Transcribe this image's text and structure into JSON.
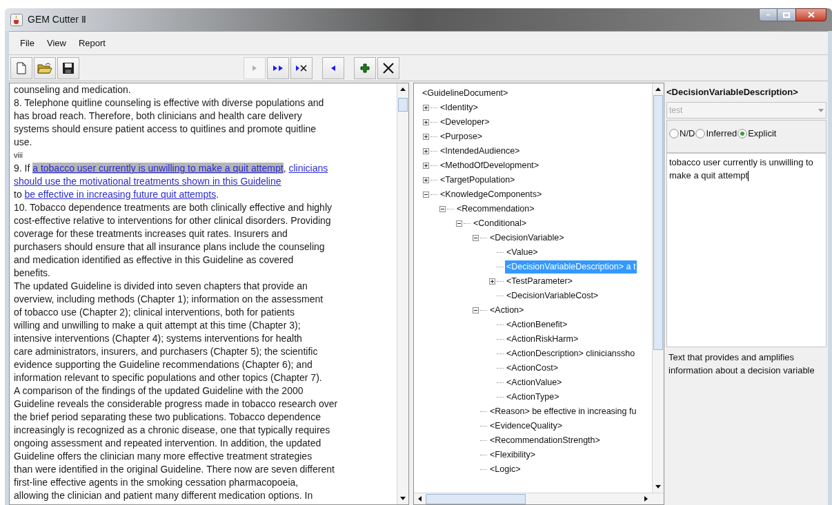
{
  "window": {
    "title": "GEM Cutter Ⅱ"
  },
  "menu": [
    "File",
    "View",
    "Report"
  ],
  "toolbar": [
    [
      {
        "kind": "new",
        "disabled": false
      },
      {
        "kind": "open",
        "disabled": false
      },
      {
        "kind": "save",
        "disabled": false
      }
    ],
    [
      {
        "kind": "step",
        "disabled": true
      },
      {
        "kind": "step_all",
        "disabled": false
      },
      {
        "kind": "step_clear",
        "disabled": false
      }
    ],
    [
      {
        "kind": "back",
        "disabled": false
      }
    ],
    [
      {
        "kind": "add",
        "disabled": false
      },
      {
        "kind": "delete",
        "disabled": false
      }
    ]
  ],
  "document": {
    "lines": [
      {
        "kind": "body",
        "segments": [
          {
            "kind": "text",
            "text": "counseling and medication."
          }
        ]
      },
      {
        "kind": "body",
        "segments": [
          {
            "kind": "text",
            "text": "8. Telephone quitline counseling is effective with diverse populations and"
          }
        ]
      },
      {
        "kind": "body",
        "segments": [
          {
            "kind": "text",
            "text": "has broad reach. Therefore, both clinicians and health care delivery"
          }
        ]
      },
      {
        "kind": "body",
        "segments": [
          {
            "kind": "text",
            "text": "systems should ensure patient access to quitlines and promote quitline"
          }
        ]
      },
      {
        "kind": "body",
        "segments": [
          {
            "kind": "text",
            "text": "use."
          }
        ]
      },
      {
        "kind": "page_number",
        "segments": [
          {
            "kind": "text",
            "text": "viii"
          }
        ]
      },
      {
        "kind": "body",
        "segments": [
          {
            "kind": "text",
            "text": "9. If "
          },
          {
            "kind": "link",
            "text": "a tobacco user currently is unwilling to make a quit attempt",
            "highlighted": true
          },
          {
            "kind": "text",
            "text": ", "
          },
          {
            "kind": "link",
            "text": "clinicians",
            "highlighted": false
          }
        ]
      },
      {
        "kind": "body",
        "segments": [
          {
            "kind": "link",
            "text": "should use the motivational treatments shown in this Guideline",
            "highlighted": false
          }
        ]
      },
      {
        "kind": "body",
        "segments": [
          {
            "kind": "text",
            "text": "to "
          },
          {
            "kind": "link",
            "text": "be effective in increasing future quit attempts",
            "highlighted": false
          },
          {
            "kind": "text",
            "text": "."
          }
        ]
      },
      {
        "kind": "body",
        "segments": [
          {
            "kind": "text",
            "text": "10. Tobacco dependence treatments are both clinically effective and highly"
          }
        ]
      },
      {
        "kind": "body",
        "segments": [
          {
            "kind": "text",
            "text": "cost-effective relative to interventions for other clinical disorders. Providing"
          }
        ]
      },
      {
        "kind": "body",
        "segments": [
          {
            "kind": "text",
            "text": "coverage for these treatments increases quit rates. Insurers and"
          }
        ]
      },
      {
        "kind": "body",
        "segments": [
          {
            "kind": "text",
            "text": "purchasers should ensure that all insurance plans include the counseling"
          }
        ]
      },
      {
        "kind": "body",
        "segments": [
          {
            "kind": "text",
            "text": "and medication identified as effective in this Guideline as covered"
          }
        ]
      },
      {
        "kind": "body",
        "segments": [
          {
            "kind": "text",
            "text": "benefits."
          }
        ]
      },
      {
        "kind": "body",
        "segments": [
          {
            "kind": "text",
            "text": "The updated Guideline is divided into seven chapters that provide an"
          }
        ]
      },
      {
        "kind": "body",
        "segments": [
          {
            "kind": "text",
            "text": "overview, including methods (Chapter 1); information on the assessment"
          }
        ]
      },
      {
        "kind": "body",
        "segments": [
          {
            "kind": "text",
            "text": "of tobacco use (Chapter 2); clinical interventions, both for patients"
          }
        ]
      },
      {
        "kind": "body",
        "segments": [
          {
            "kind": "text",
            "text": "willing and unwilling to make a quit attempt at this time (Chapter 3);"
          }
        ]
      },
      {
        "kind": "body",
        "segments": [
          {
            "kind": "text",
            "text": "intensive interventions (Chapter 4); systems interventions for health"
          }
        ]
      },
      {
        "kind": "body",
        "segments": [
          {
            "kind": "text",
            "text": "care administrators, insurers, and purchasers (Chapter 5); the scientific"
          }
        ]
      },
      {
        "kind": "body",
        "segments": [
          {
            "kind": "text",
            "text": "evidence supporting the Guideline recommendations (Chapter 6); and"
          }
        ]
      },
      {
        "kind": "body",
        "segments": [
          {
            "kind": "text",
            "text": "information relevant to specific populations and other topics (Chapter 7)."
          }
        ]
      },
      {
        "kind": "body",
        "segments": [
          {
            "kind": "text",
            "text": "A comparison of the findings of the updated Guideline with the 2000"
          }
        ]
      },
      {
        "kind": "body",
        "segments": [
          {
            "kind": "text",
            "text": "Guideline reveals the considerable progress made in tobacco research over"
          }
        ]
      },
      {
        "kind": "body",
        "segments": [
          {
            "kind": "text",
            "text": "the brief period separating these two publications. Tobacco dependence"
          }
        ]
      },
      {
        "kind": "body",
        "segments": [
          {
            "kind": "text",
            "text": "increasingly is recognized as a chronic disease, one that typically requires"
          }
        ]
      },
      {
        "kind": "body",
        "segments": [
          {
            "kind": "text",
            "text": "ongoing assessment and repeated intervention. In addition, the updated"
          }
        ]
      },
      {
        "kind": "body",
        "segments": [
          {
            "kind": "text",
            "text": "Guideline offers the clinician many more effective treatment strategies"
          }
        ]
      },
      {
        "kind": "body",
        "segments": [
          {
            "kind": "text",
            "text": "than were identified in the original Guideline. There now are seven different"
          }
        ]
      },
      {
        "kind": "body",
        "segments": [
          {
            "kind": "text",
            "text": "first-line effective agents in the smoking cessation pharmacopoeia,"
          }
        ]
      },
      {
        "kind": "body",
        "segments": [
          {
            "kind": "text",
            "text": "allowing the clinician and patient many different medication options. In"
          }
        ]
      }
    ]
  },
  "tree": {
    "root": {
      "label": "<GuidelineDocument>",
      "kind": "root",
      "selected": false,
      "children": [
        {
          "label": "<Identity>",
          "kind": "branch",
          "expanded": false,
          "selected": false
        },
        {
          "label": "<Developer>",
          "kind": "branch",
          "expanded": false,
          "selected": false
        },
        {
          "label": "<Purpose>",
          "kind": "branch",
          "expanded": false,
          "selected": false
        },
        {
          "label": "<IntendedAudience>",
          "kind": "branch",
          "expanded": false,
          "selected": false
        },
        {
          "label": "<MethodOfDevelopment>",
          "kind": "branch",
          "expanded": false,
          "selected": false
        },
        {
          "label": "<TargetPopulation>",
          "kind": "branch",
          "expanded": false,
          "selected": false
        },
        {
          "label": "<KnowledgeComponents>",
          "kind": "branch",
          "expanded": true,
          "selected": false,
          "children": [
            {
              "label": "<Recommendation>",
              "kind": "branch",
              "expanded": true,
              "selected": false,
              "children": [
                {
                  "label": "<Conditional>",
                  "kind": "branch",
                  "expanded": true,
                  "selected": false,
                  "children": [
                    {
                      "label": "<DecisionVariable>",
                      "kind": "branch",
                      "expanded": true,
                      "selected": false,
                      "children": [
                        {
                          "label": "<Value>",
                          "kind": "leaf",
                          "selected": false
                        },
                        {
                          "label": "<DecisionVariableDescription> a t",
                          "kind": "leaf",
                          "selected": true
                        },
                        {
                          "label": "<TestParameter>",
                          "kind": "branch",
                          "expanded": false,
                          "selected": false
                        },
                        {
                          "label": "<DecisionVariableCost>",
                          "kind": "leaf",
                          "selected": false
                        }
                      ]
                    },
                    {
                      "label": "<Action>",
                      "kind": "branch",
                      "expanded": true,
                      "selected": false,
                      "children": [
                        {
                          "label": "<ActionBenefit>",
                          "kind": "leaf",
                          "selected": false
                        },
                        {
                          "label": "<ActionRiskHarm>",
                          "kind": "leaf",
                          "selected": false
                        },
                        {
                          "label": "<ActionDescription> clinicianssho",
                          "kind": "leaf",
                          "selected": false
                        },
                        {
                          "label": "<ActionCost>",
                          "kind": "leaf",
                          "selected": false
                        },
                        {
                          "label": "<ActionValue>",
                          "kind": "leaf",
                          "selected": false
                        },
                        {
                          "label": "<ActionType>",
                          "kind": "leaf",
                          "selected": false
                        }
                      ]
                    },
                    {
                      "label": "<Reason> be effective in increasing fu",
                      "kind": "leaf",
                      "selected": false
                    },
                    {
                      "label": "<EvidenceQuality>",
                      "kind": "leaf",
                      "selected": false
                    },
                    {
                      "label": "<RecommendationStrength>",
                      "kind": "leaf",
                      "selected": false
                    },
                    {
                      "label": "<Flexibility>",
                      "kind": "leaf",
                      "selected": false
                    },
                    {
                      "label": "<Logic>",
                      "kind": "leaf",
                      "selected": false
                    }
                  ]
                }
              ]
            }
          ]
        }
      ]
    }
  },
  "element_panel": {
    "title": "<DecisionVariableDescription>",
    "dropdown": {
      "value": "test",
      "disabled": true
    },
    "sources": [
      {
        "label": "N/D",
        "selected": false
      },
      {
        "label": "Inferred",
        "selected": false
      },
      {
        "label": "Explicit",
        "selected": true
      }
    ],
    "text": "tobacco user currently is unwilling to make a quit attempt",
    "description": "Text that provides and amplifies information about a decision variable"
  }
}
